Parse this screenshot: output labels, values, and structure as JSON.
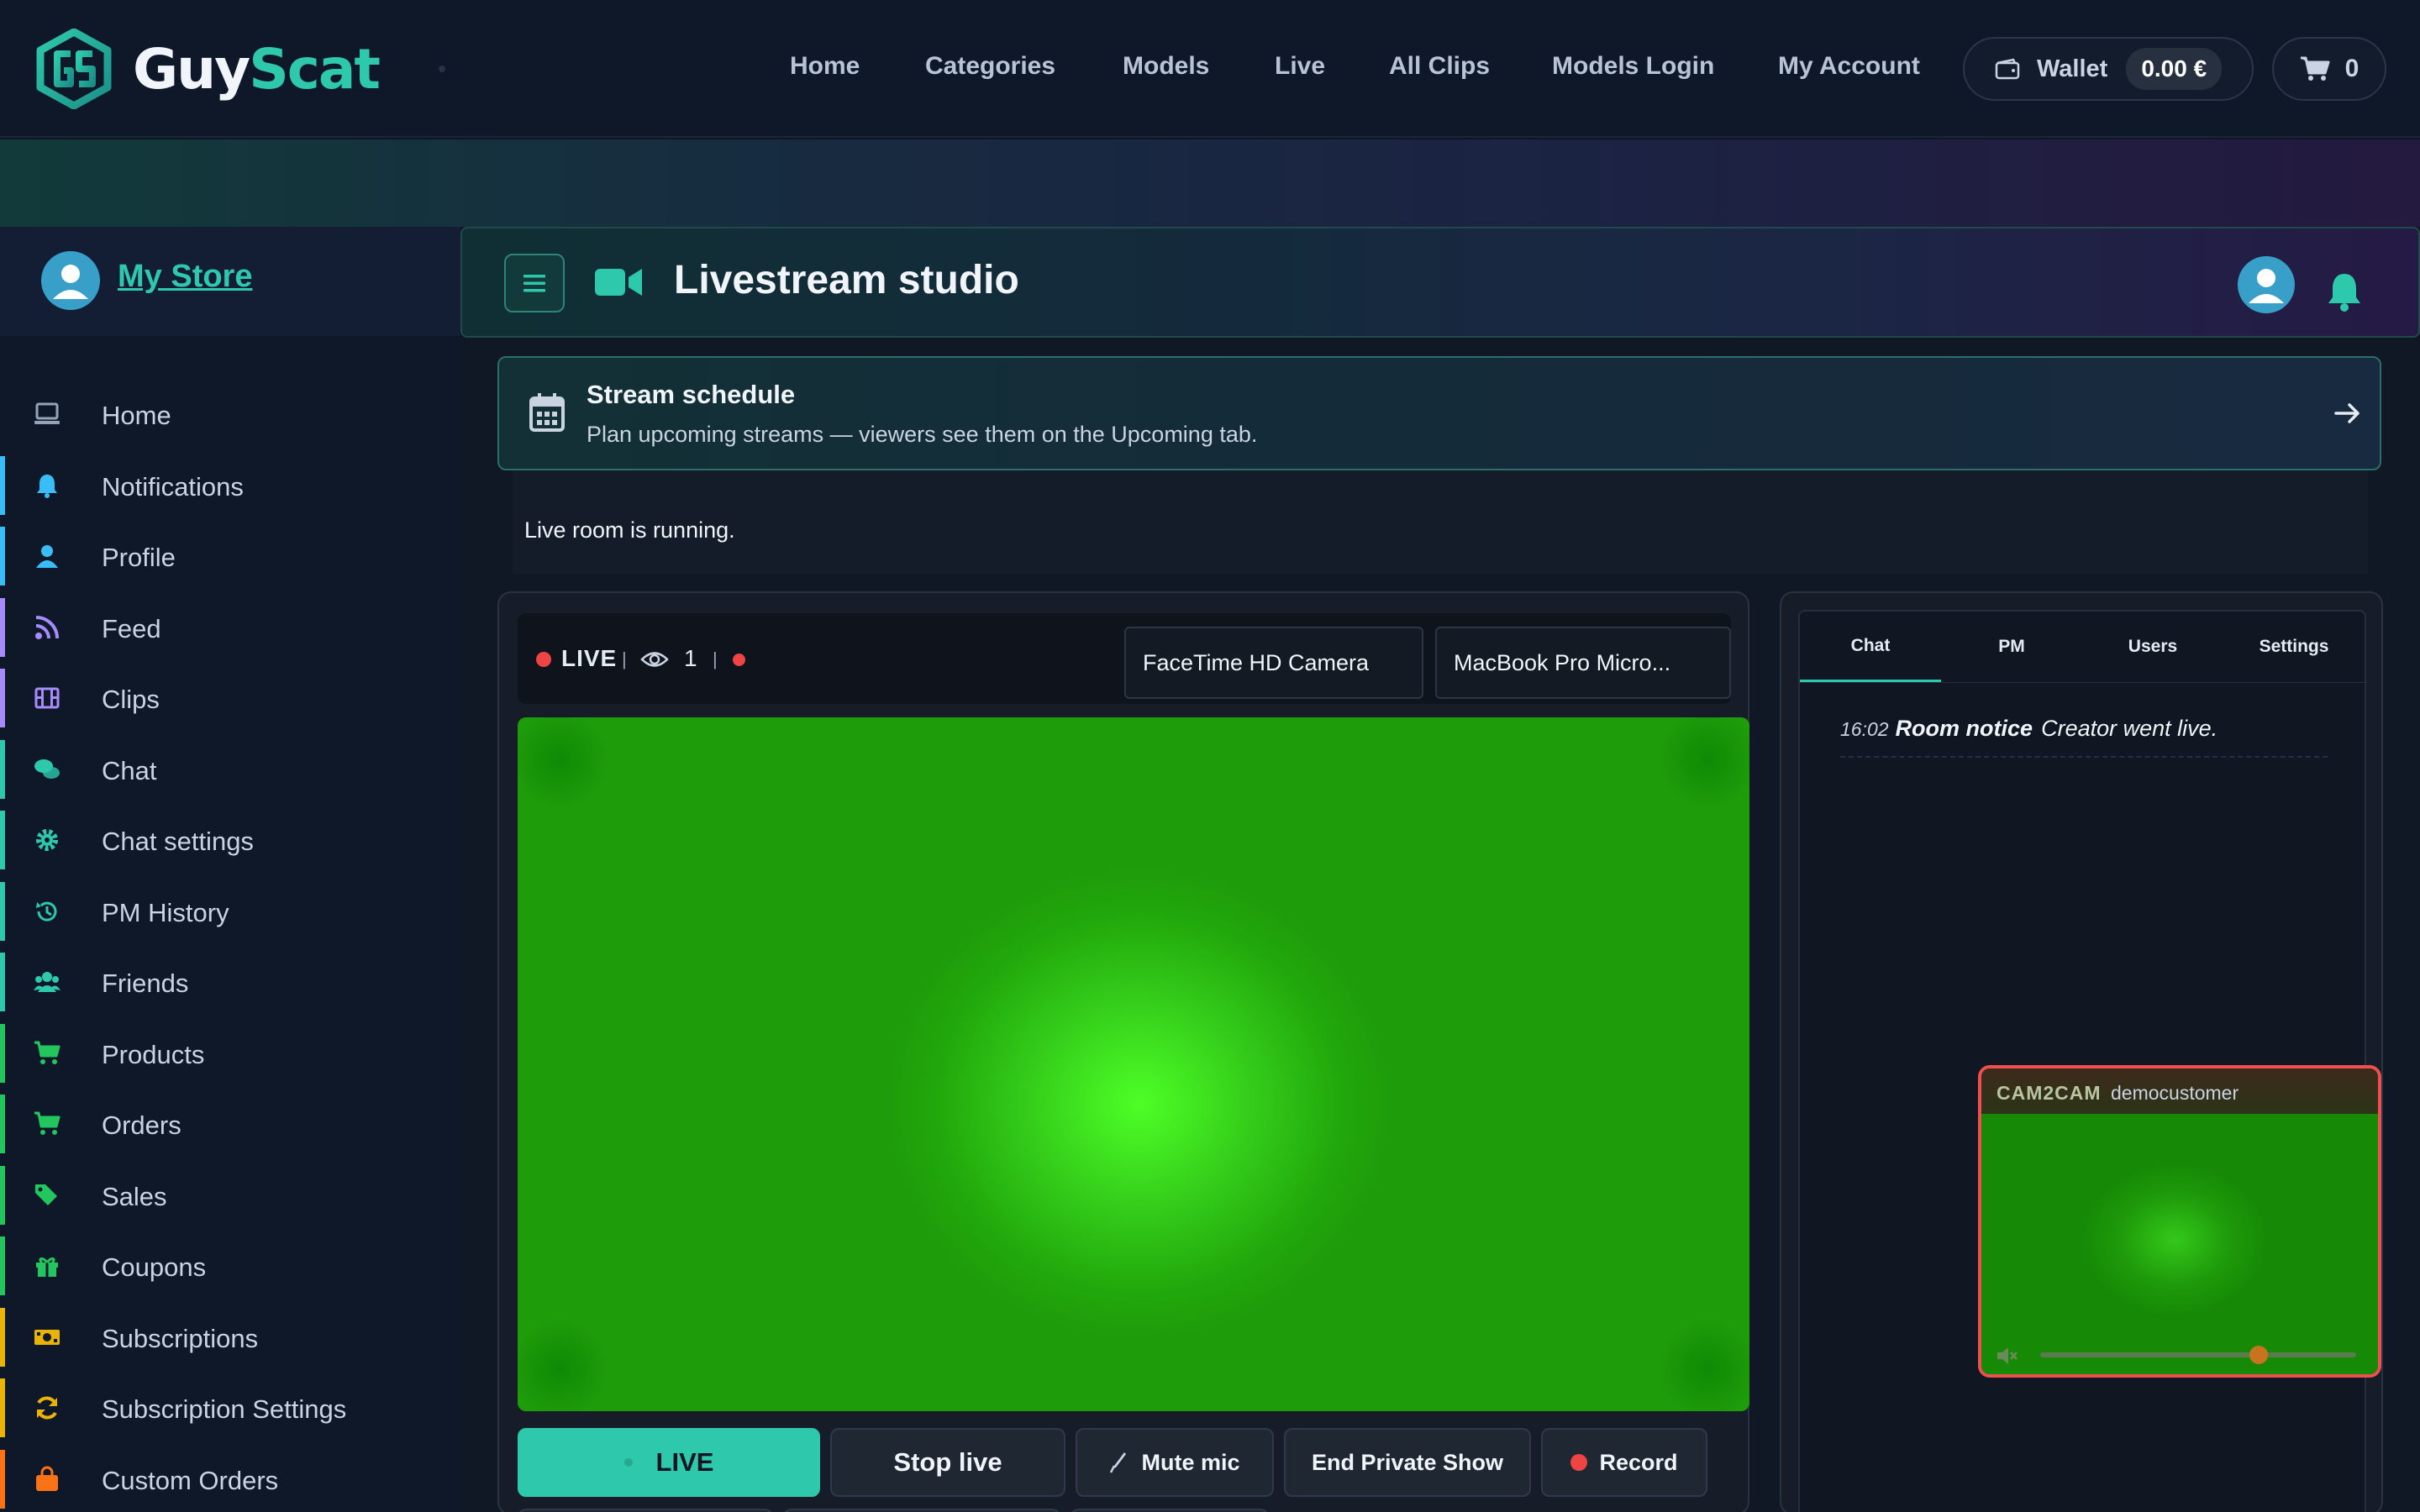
{
  "brand": {
    "name_part1": "Guy",
    "name_part2": "Scat",
    "accent": "#2ec9ad"
  },
  "topnav": {
    "links": [
      "Home",
      "Categories",
      "Models",
      "Live",
      "All Clips",
      "Models Login",
      "My Account"
    ],
    "wallet_label": "Wallet",
    "wallet_balance": "0.00 €",
    "cart_count": "0"
  },
  "sidebar": {
    "store_label": "My Store",
    "items": [
      {
        "label": "Home",
        "icon": "laptop-icon",
        "color": "#94a3b8"
      },
      {
        "label": "Notifications",
        "icon": "bell-icon",
        "color": "#38bdf8"
      },
      {
        "label": "Profile",
        "icon": "user-icon",
        "color": "#38bdf8"
      },
      {
        "label": "Feed",
        "icon": "rss-icon",
        "color": "#a78bfa"
      },
      {
        "label": "Clips",
        "icon": "film-icon",
        "color": "#a78bfa"
      },
      {
        "label": "Chat",
        "icon": "chat-bubbles-icon",
        "color": "#2ec9ad"
      },
      {
        "label": "Chat settings",
        "icon": "gear-icon",
        "color": "#2ec9ad"
      },
      {
        "label": "PM History",
        "icon": "history-icon",
        "color": "#2ec9ad"
      },
      {
        "label": "Friends",
        "icon": "users-icon",
        "color": "#2ec9ad"
      },
      {
        "label": "Products",
        "icon": "cart-icon",
        "color": "#22c55e"
      },
      {
        "label": "Orders",
        "icon": "cart-icon",
        "color": "#22c55e"
      },
      {
        "label": "Sales",
        "icon": "tags-icon",
        "color": "#22c55e"
      },
      {
        "label": "Coupons",
        "icon": "gift-icon",
        "color": "#22c55e"
      },
      {
        "label": "Subscriptions",
        "icon": "money-icon",
        "color": "#eab308"
      },
      {
        "label": "Subscription Settings",
        "icon": "refresh-icon",
        "color": "#eab308"
      },
      {
        "label": "Custom Orders",
        "icon": "bag-icon",
        "color": "#f97316"
      }
    ]
  },
  "studio": {
    "title": "Livestream studio",
    "schedule_title": "Stream schedule",
    "schedule_subtitle": "Plan upcoming streams — viewers see them on the Upcoming tab.",
    "room_status": "Live room is running."
  },
  "video": {
    "live_label": "LIVE",
    "viewer_count": "1",
    "camera_select": "FaceTime HD Camera",
    "mic_select": "MacBook Pro Micro...",
    "buttons": {
      "live": "LIVE",
      "stop_live": "Stop live",
      "mute_mic": "Mute mic",
      "end_private": "End Private Show",
      "record": "Record"
    }
  },
  "chat": {
    "tabs": [
      "Chat",
      "PM",
      "Users",
      "Settings"
    ],
    "message": {
      "time": "16:02",
      "author": "Room notice",
      "text": "Creator went live."
    },
    "cam2cam": {
      "tag": "CAM2CAM",
      "user": "democustomer",
      "volume": 0.62
    }
  }
}
